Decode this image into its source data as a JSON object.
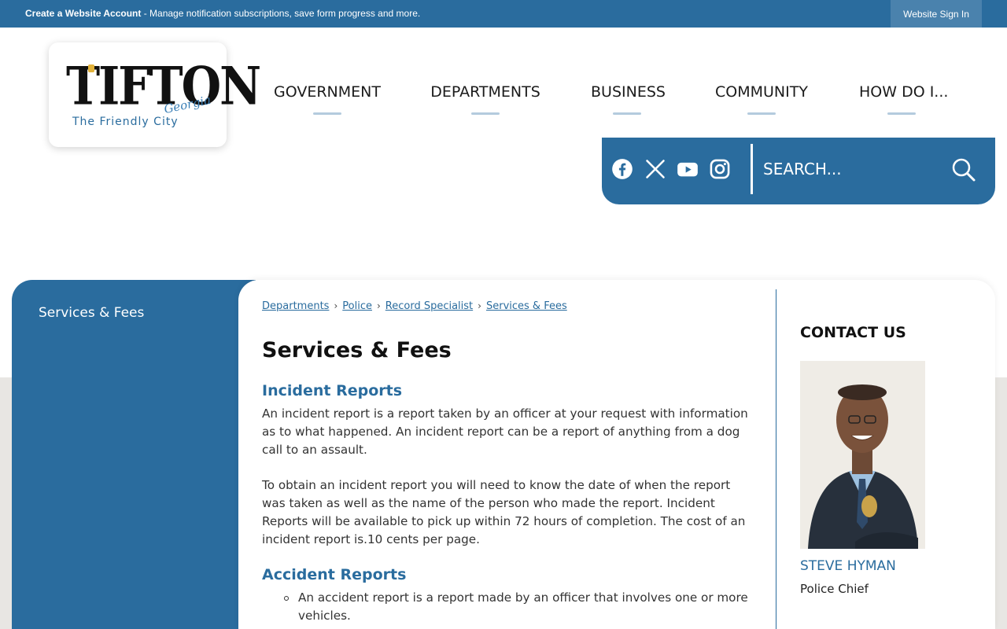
{
  "topbar": {
    "create_account": "Create a Website Account",
    "message": " - Manage notification subscriptions, save form progress and more.",
    "signin": "Website Sign In"
  },
  "logo": {
    "word": "TIFTON",
    "state": "Georgia",
    "tagline": "The Friendly City"
  },
  "nav": [
    "GOVERNMENT",
    "DEPARTMENTS",
    "BUSINESS",
    "COMMUNITY",
    "HOW DO I..."
  ],
  "social": {
    "icons": [
      "facebook-icon",
      "x-icon",
      "youtube-icon",
      "instagram-icon"
    ],
    "search_placeholder": "SEARCH..."
  },
  "sidebar": {
    "items": [
      {
        "label": "Services & Fees"
      }
    ]
  },
  "breadcrumb": [
    "Departments",
    "Police",
    "Record Specialist",
    "Services & Fees"
  ],
  "main": {
    "title": "Services & Fees",
    "incident_heading": "Incident Reports",
    "incident_p1": "An incident report is a report taken by an officer at your request with information as to what happened. An incident report can be a report of anything from a dog call to an assault.",
    "incident_p2": "To obtain an incident report you will need to know the date of when the report was taken as well as the name of the person who made the report. Incident Reports will be available to pick up within 72 hours of completion. The cost of an incident report is.10 cents per page.",
    "accident_heading": "Accident Reports",
    "accident_bullets": [
      "An accident report is a report made by an officer that involves one or more vehicles."
    ]
  },
  "contact": {
    "heading": "CONTACT US",
    "name": "STEVE HYMAN",
    "role": "Police Chief"
  },
  "colors": {
    "brand_blue": "#2a6c9e",
    "gray_band": "#e8e6e3"
  }
}
